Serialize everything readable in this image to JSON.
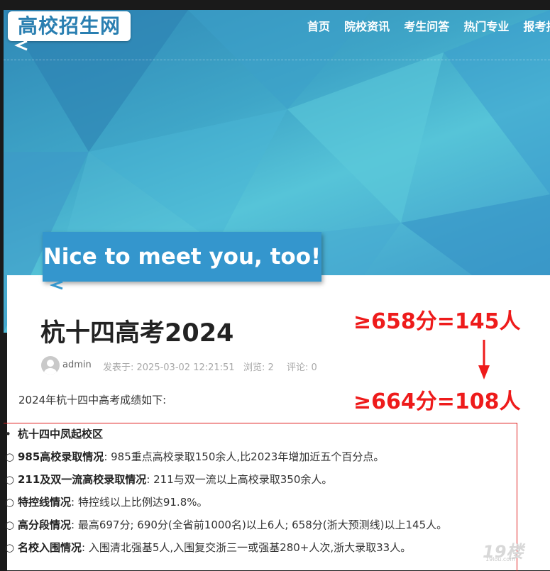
{
  "site": {
    "logo": "高校招生网"
  },
  "nav": [
    "首页",
    "院校资讯",
    "考生问答",
    "热门专业",
    "报考指南"
  ],
  "banner": {
    "text": "Nice to meet you, too!"
  },
  "article": {
    "title": "杭十四高考2024",
    "author": "admin",
    "published": "发表于: 2025-03-02 12:21:51",
    "views": "浏览: 2",
    "comments": "评论: 0",
    "intro": "2024年杭十四中高考成绩如下:",
    "items": [
      {
        "bullet": "•",
        "label": "杭十四中凤起校区",
        "text": ""
      },
      {
        "bullet": "○",
        "label": "985高校录取情况",
        "text": ": 985重点高校录取150余人,比2023年增加近五个百分点。"
      },
      {
        "bullet": "○",
        "label": "211及双一流高校录取情况",
        "text": ": 211与双一流以上高校录取350余人。"
      },
      {
        "bullet": "○",
        "label": "特控线情况",
        "text": ": 特控线以上比例达91.8%。"
      },
      {
        "bullet": "○",
        "label": "高分段情况",
        "text": ": 最高697分; 690分(全省前1000名)以上6人; 658分(浙大预测线)以上145人。"
      },
      {
        "bullet": "○",
        "label": "名校入围情况",
        "text": ": 入围清北强基5人,入围复交浙三一或强基280+人次,浙大录取33人。"
      }
    ]
  },
  "annotations": [
    "≥658分=145人",
    "≥664分=108人"
  ],
  "watermark": {
    "main": "19楼",
    "sub": "19lou.com"
  },
  "colors": {
    "annotation": "#ee1b1b",
    "brand": "#3496cd",
    "logo_text": "#2a7fb1"
  }
}
